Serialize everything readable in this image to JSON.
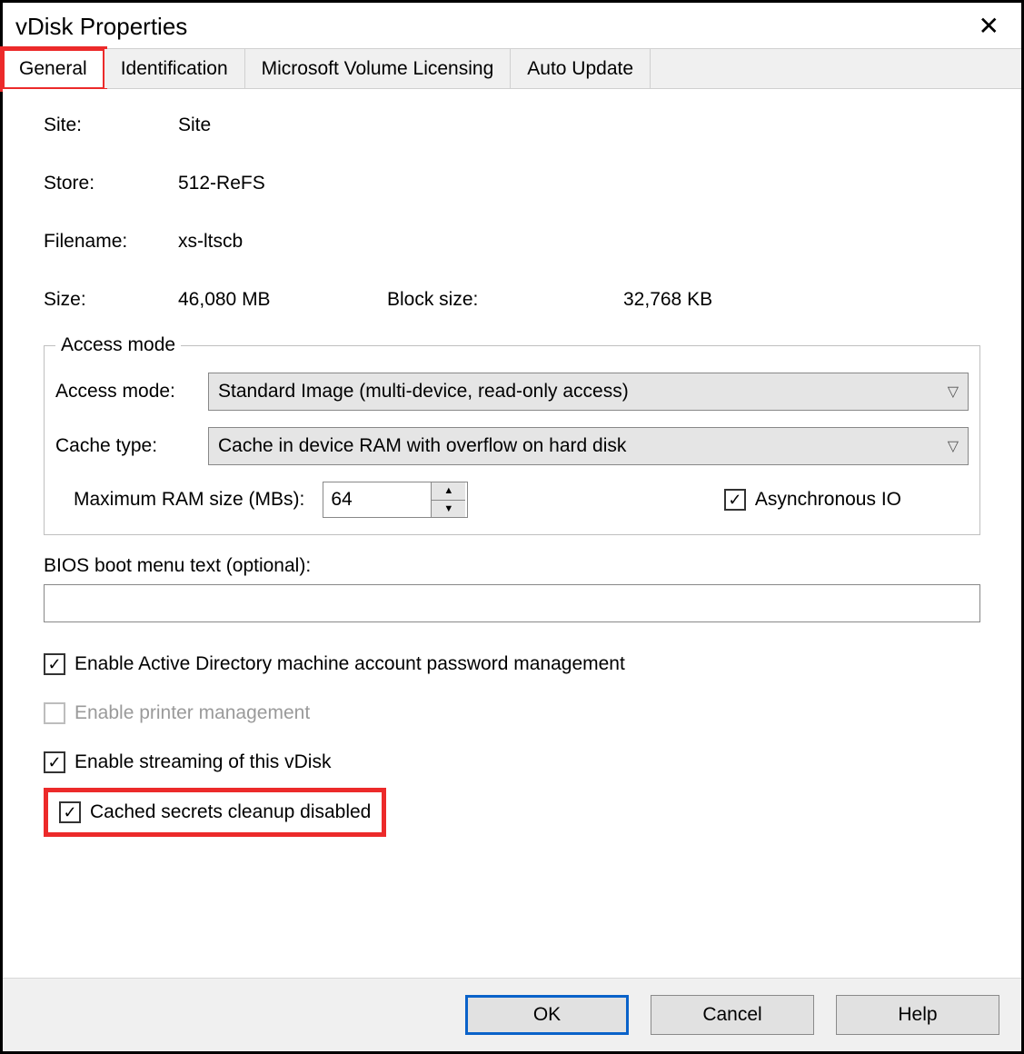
{
  "window": {
    "title": "vDisk Properties"
  },
  "tabs": [
    "General",
    "Identification",
    "Microsoft Volume Licensing",
    "Auto Update"
  ],
  "fields": {
    "site_label": "Site:",
    "site_value": "Site",
    "store_label": "Store:",
    "store_value": "512-ReFS",
    "filename_label": "Filename:",
    "filename_value": "xs-ltscb",
    "size_label": "Size:",
    "size_value": "46,080 MB",
    "blocksize_label": "Block size:",
    "blocksize_value": "32,768 KB"
  },
  "access": {
    "legend": "Access mode",
    "mode_label": "Access mode:",
    "mode_value": "Standard Image (multi-device, read-only access)",
    "cache_label": "Cache type:",
    "cache_value": "Cache in device RAM with overflow on hard disk",
    "ram_label": "Maximum RAM size (MBs):",
    "ram_value": "64",
    "async_label": "Asynchronous IO"
  },
  "bios": {
    "label": "BIOS boot menu text (optional):",
    "value": ""
  },
  "checks": {
    "ad": "Enable Active Directory machine account password management",
    "printer": "Enable printer management",
    "streaming": "Enable streaming of this vDisk",
    "secrets": "Cached secrets cleanup disabled"
  },
  "buttons": {
    "ok": "OK",
    "cancel": "Cancel",
    "help": "Help"
  }
}
